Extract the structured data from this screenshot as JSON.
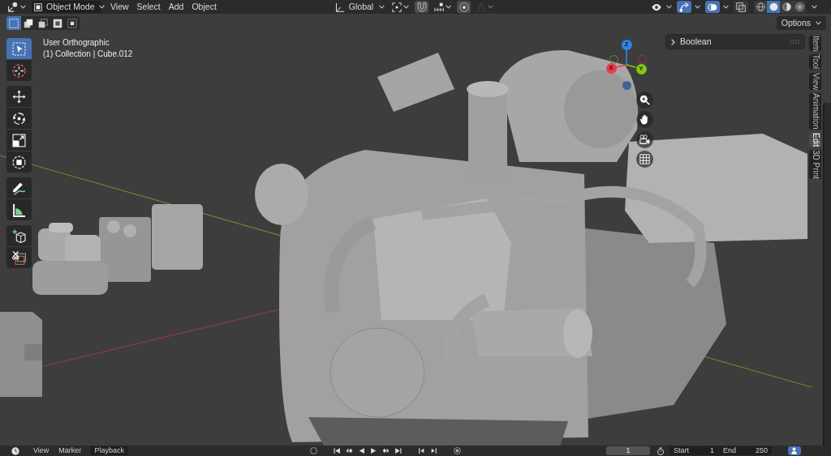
{
  "header": {
    "editor_type": {
      "kind": "viewport"
    },
    "mode": {
      "label": "Object Mode"
    },
    "menus": [
      {
        "label": "View"
      },
      {
        "label": "Select"
      },
      {
        "label": "Add"
      },
      {
        "label": "Object"
      }
    ],
    "orientation": {
      "label": "Global"
    },
    "snapping_tools": [
      {
        "kind": "pivot",
        "disabled": false
      },
      {
        "kind": "snap",
        "disabled": false
      },
      {
        "kind": "snap-target",
        "disabled": false
      },
      {
        "kind": "proportional",
        "disabled": false
      },
      {
        "kind": "falloff",
        "disabled": true
      }
    ],
    "view_toggles": [
      {
        "kind": "visibility",
        "on": false
      },
      {
        "kind": "gizmos",
        "on": true
      },
      {
        "kind": "overlays",
        "on": true
      },
      {
        "kind": "xray",
        "on": false
      }
    ],
    "shading": [
      {
        "kind": "wireframe",
        "selected": false
      },
      {
        "kind": "solid",
        "selected": true
      },
      {
        "kind": "material",
        "selected": false
      },
      {
        "kind": "rendered",
        "selected": false
      }
    ]
  },
  "tool_header": {
    "select_modes": [
      {
        "kind": "new",
        "selected": true
      },
      {
        "kind": "extend",
        "selected": false
      },
      {
        "kind": "subtract",
        "selected": false
      },
      {
        "kind": "invert",
        "selected": false
      },
      {
        "kind": "intersect",
        "selected": false
      }
    ],
    "options": {
      "label": "Options"
    }
  },
  "viewport": {
    "view_name": "User Orthographic",
    "context": "(1) Collection | Cube.012"
  },
  "toolbar": [
    {
      "tools": [
        {
          "kind": "select-box",
          "selected": true
        },
        {
          "kind": "cursor",
          "selected": false
        }
      ]
    },
    {
      "tools": [
        {
          "kind": "move",
          "selected": false
        },
        {
          "kind": "rotate",
          "selected": false
        },
        {
          "kind": "scale",
          "selected": false
        },
        {
          "kind": "transform",
          "selected": false
        }
      ]
    },
    {
      "tools": [
        {
          "kind": "annotate",
          "selected": false
        },
        {
          "kind": "measure",
          "selected": false
        }
      ]
    },
    {
      "tools": [
        {
          "kind": "add-cube",
          "selected": false
        },
        {
          "kind": "cut",
          "selected": false
        }
      ]
    }
  ],
  "gizmo": {
    "axes": [
      {
        "kind": "positive",
        "label": "Z",
        "color": "#2f86e8"
      },
      {
        "kind": "negative",
        "color": "#6e8a22"
      },
      {
        "kind": "negative",
        "color": "#a8323f"
      },
      {
        "kind": "positive",
        "label": "X",
        "color": "#f0394b"
      },
      {
        "kind": "positive",
        "label": "Y",
        "color": "#82c80e"
      },
      {
        "kind": "negative",
        "color": "#3c6396"
      }
    ]
  },
  "navigation": [
    {
      "kind": "zoom"
    },
    {
      "kind": "pan"
    },
    {
      "kind": "camera"
    },
    {
      "kind": "perspective"
    }
  ],
  "sidebar": {
    "panels": [
      {
        "label": "Boolean",
        "expanded": false
      }
    ],
    "tabs": [
      {
        "label": "Item",
        "selected": false
      },
      {
        "label": "Tool",
        "selected": false
      },
      {
        "label": "View",
        "selected": false
      },
      {
        "label": "Animation",
        "selected": false
      },
      {
        "label": "Edit",
        "selected": true
      },
      {
        "label": "3D Print",
        "selected": false
      }
    ]
  },
  "timeline": {
    "menus": [
      {
        "label": "View"
      },
      {
        "label": "Marker"
      },
      {
        "label": "Playback"
      }
    ],
    "controls": [
      {
        "kind": "keying"
      },
      {
        "kind": "jump-start"
      },
      {
        "kind": "prev-key"
      },
      {
        "kind": "play-reverse"
      },
      {
        "kind": "play"
      },
      {
        "kind": "next-key"
      },
      {
        "kind": "jump-end"
      },
      {
        "kind": "prev-marker"
      },
      {
        "kind": "next-marker"
      },
      {
        "kind": "auto-key"
      }
    ],
    "current_frame": "1",
    "start": {
      "label": "Start",
      "value": "1"
    },
    "end": {
      "label": "End",
      "value": "250"
    },
    "range_toggle": {
      "on": true
    }
  }
}
